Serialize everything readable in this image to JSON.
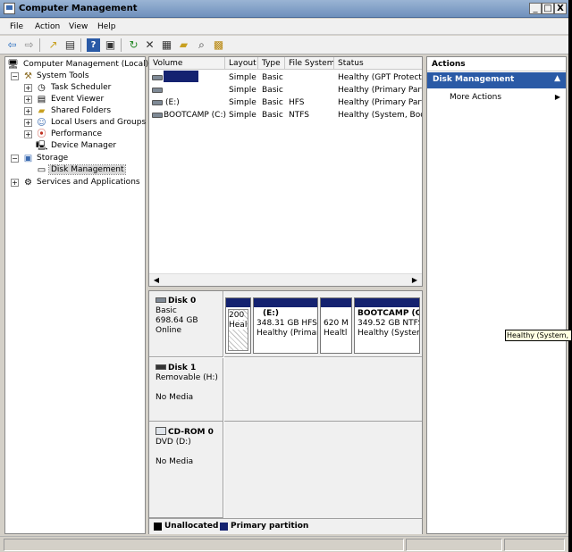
{
  "window": {
    "title": "Computer Management",
    "minimize": "_",
    "maximize": "□",
    "close": "X"
  },
  "menu": [
    "File",
    "Action",
    "View",
    "Help"
  ],
  "toolbar_icons": [
    "back-icon",
    "forward-icon",
    "up-folder-icon",
    "show-hide-tree-icon",
    "help-icon",
    "console-icon",
    "refresh-icon",
    "delete-icon",
    "properties-icon",
    "open-icon",
    "search-icon",
    "disk-wizard-icon"
  ],
  "tree": {
    "root": "Computer Management (Local)",
    "system_tools": "System Tools",
    "task_scheduler": "Task Scheduler",
    "event_viewer": "Event Viewer",
    "shared_folders": "Shared Folders",
    "local_users": "Local Users and Groups",
    "performance": "Performance",
    "device_manager": "Device Manager",
    "storage": "Storage",
    "disk_management": "Disk Management",
    "services": "Services and Applications"
  },
  "volume_table": {
    "headers": [
      "Volume",
      "Layout",
      "Type",
      "File System",
      "Status"
    ],
    "rows": [
      {
        "volume": "",
        "layout": "Simple",
        "type": "Basic",
        "fs": "",
        "status": "Healthy (GPT Protective"
      },
      {
        "volume": "",
        "layout": "Simple",
        "type": "Basic",
        "fs": "",
        "status": "Healthy (Primary Partiti"
      },
      {
        "volume": "(E:)",
        "layout": "Simple",
        "type": "Basic",
        "fs": "HFS",
        "status": "Healthy (Primary Partiti"
      },
      {
        "volume": "BOOTCAMP (C:)",
        "layout": "Simple",
        "type": "Basic",
        "fs": "NTFS",
        "status": "Healthy (System, Boot,"
      }
    ]
  },
  "disks": {
    "disk0": {
      "name": "Disk 0",
      "type": "Basic",
      "size": "698.64 GB",
      "state": "Online"
    },
    "disk0_parts": {
      "p1": {
        "l1": "200",
        "l2": "Heal"
      },
      "p2": {
        "title": "(E:)",
        "l1": "348.31 GB HFS",
        "l2": "Healthy (Primar"
      },
      "p3": {
        "l1": "620 M",
        "l2": "Healtl"
      },
      "p4": {
        "title": "BOOTCAMP  (C",
        "l1": "349.52 GB NTFS",
        "l2": "Healthy (System"
      }
    },
    "disk1": {
      "name": "Disk 1",
      "type": "Removable (H:)",
      "state": "No Media"
    },
    "cdrom0": {
      "name": "CD-ROM 0",
      "type": "DVD (D:)",
      "state": "No Media"
    }
  },
  "legend": {
    "unallocated": "Unallocated",
    "primary": "Primary partition"
  },
  "actions": {
    "header": "Actions",
    "section": "Disk Management",
    "more": "More Actions"
  },
  "tooltip": "Healthy (System, B",
  "colors": {
    "primary_partition": "#142270",
    "unallocated": "#000000",
    "actions_header": "#2a5aa6"
  }
}
